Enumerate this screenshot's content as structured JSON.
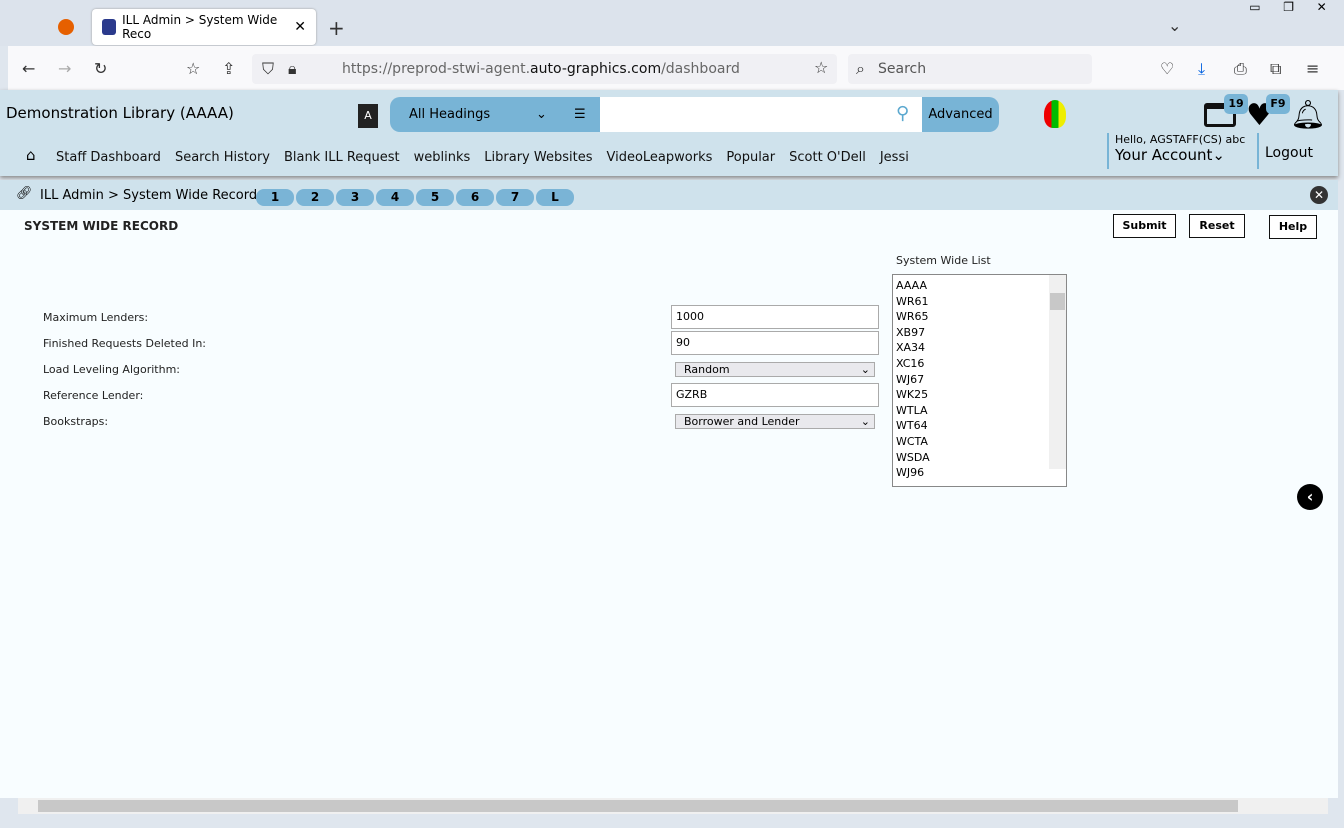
{
  "browser": {
    "tab_title": "ILL Admin > System Wide Reco",
    "url_prefix": "https://preprod-stwi-agent.",
    "url_domain": "auto-graphics.com",
    "url_path": "/dashboard",
    "search_placeholder": "Search"
  },
  "header": {
    "library": "Demonstration Library (AAAA)",
    "heading_select": "All Headings",
    "advanced": "Advanced",
    "list_badge": "19",
    "fav_badge": "F9",
    "greeting": "Hello, AGSTAFF(CS) abc",
    "account": "Your Account",
    "logout": "Logout",
    "nav": [
      "Staff Dashboard",
      "Search History",
      "Blank ILL Request",
      "weblinks",
      "Library Websites",
      "VideoLeapworks",
      "Popular",
      "Scott O'Dell",
      "Jessi"
    ]
  },
  "breadcrumb": {
    "text": "ILL Admin > System Wide Record",
    "pills": [
      "1",
      "2",
      "3",
      "4",
      "5",
      "6",
      "7",
      "L"
    ]
  },
  "main": {
    "title": "SYSTEM WIDE RECORD",
    "submit": "Submit",
    "reset": "Reset",
    "help": "Help",
    "fields": [
      {
        "label": "Maximum Lenders:",
        "value": "1000",
        "type": "input"
      },
      {
        "label": "Finished Requests Deleted In:",
        "value": "90",
        "type": "input"
      },
      {
        "label": "Load Leveling Algorithm:",
        "value": "Random",
        "type": "select"
      },
      {
        "label": "Reference Lender:",
        "value": "GZRB",
        "type": "input"
      },
      {
        "label": "Bookstraps:",
        "value": "Borrower and Lender",
        "type": "select"
      }
    ],
    "list_label": "System Wide List",
    "list": [
      "AAAA",
      "WR61",
      "WR65",
      "XB97",
      "XA34",
      "XC16",
      "WJ67",
      "WK25",
      "WTLA",
      "WT64",
      "WCTA",
      "WSDA",
      "WJ96"
    ]
  }
}
